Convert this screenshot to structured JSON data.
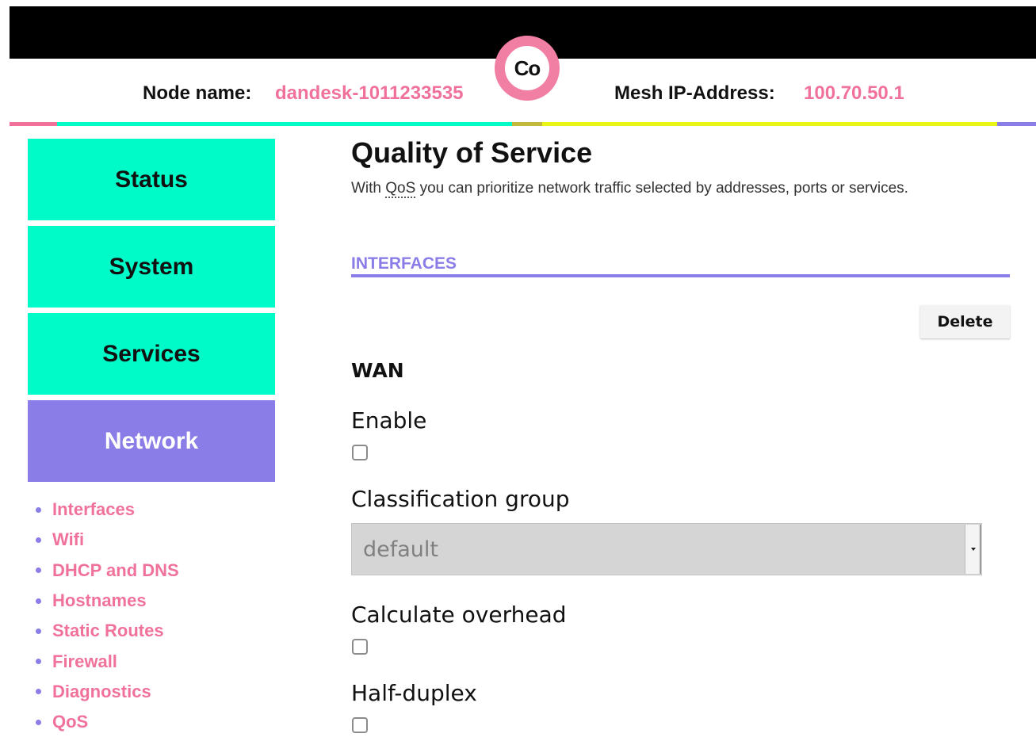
{
  "header": {
    "node_name_label": "Node name:",
    "node_name_value": "dandesk-1011233535",
    "mesh_ip_label": "Mesh IP-Address:",
    "mesh_ip_value": "100.70.50.1",
    "logo_text": "Co"
  },
  "colors": {
    "accent_pink": "#f0729b",
    "accent_teal": "#00fbc8",
    "accent_purple": "#8a7de8",
    "accent_yellow": "#eaf516",
    "accent_olive": "#c4b83c"
  },
  "sidebar": {
    "nav": [
      {
        "label": "Status"
      },
      {
        "label": "System"
      },
      {
        "label": "Services"
      },
      {
        "label": "Network",
        "active": true
      }
    ],
    "subnav": [
      {
        "label": "Interfaces"
      },
      {
        "label": "Wifi"
      },
      {
        "label": "DHCP and DNS"
      },
      {
        "label": "Hostnames"
      },
      {
        "label": "Static Routes"
      },
      {
        "label": "Firewall"
      },
      {
        "label": "Diagnostics"
      },
      {
        "label": "QoS"
      }
    ]
  },
  "main": {
    "title": "Quality of Service",
    "description_prefix": "With ",
    "description_abbr": "QoS",
    "description_suffix": " you can prioritize network traffic selected by addresses, ports or services.",
    "section_title": "INTERFACES",
    "delete_label": "Delete",
    "interface_name": "WAN",
    "fields": {
      "enable_label": "Enable",
      "enable_checked": false,
      "classification_label": "Classification group",
      "classification_value": "default",
      "overhead_label": "Calculate overhead",
      "overhead_checked": false,
      "halfduplex_label": "Half-duplex",
      "halfduplex_checked": false
    }
  }
}
